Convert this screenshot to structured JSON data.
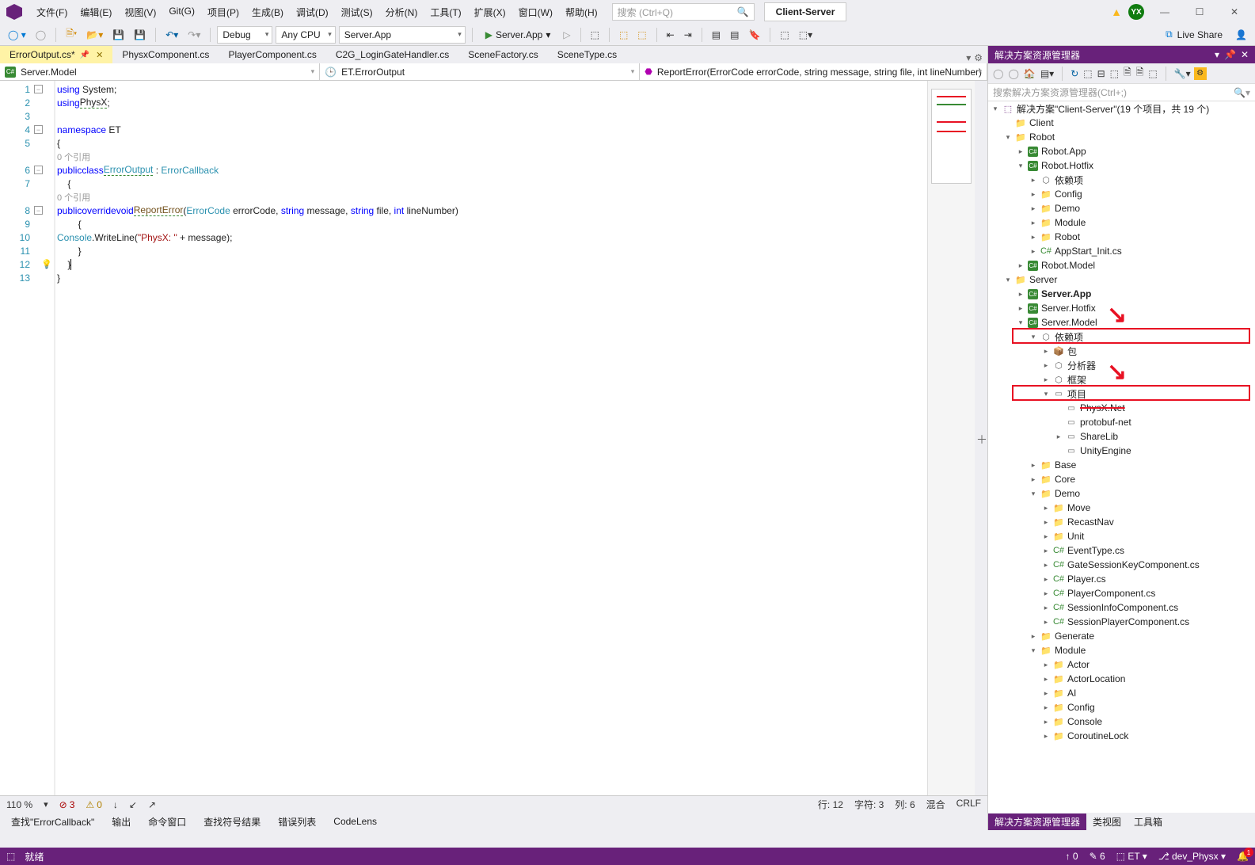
{
  "title": {
    "solution_name": "Client-Server",
    "avatar": "YX"
  },
  "menu": [
    "文件(F)",
    "编辑(E)",
    "视图(V)",
    "Git(G)",
    "项目(P)",
    "生成(B)",
    "调试(D)",
    "测试(S)",
    "分析(N)",
    "工具(T)",
    "扩展(X)",
    "窗口(W)",
    "帮助(H)"
  ],
  "search_placeholder": "搜索 (Ctrl+Q)",
  "toolbar": {
    "config": "Debug",
    "platform": "Any CPU",
    "startup": "Server.App",
    "run": "Server.App",
    "liveshare": "Live Share"
  },
  "tabs": [
    {
      "label": "ErrorOutput.cs*",
      "active": true,
      "pinned": true
    },
    {
      "label": "PhysxComponent.cs"
    },
    {
      "label": "PlayerComponent.cs"
    },
    {
      "label": "C2G_LoginGateHandler.cs"
    },
    {
      "label": "SceneFactory.cs"
    },
    {
      "label": "SceneType.cs"
    }
  ],
  "navbar": {
    "scope": "Server.Model",
    "class": "ET.ErrorOutput",
    "member": "ReportError(ErrorCode errorCode, string message, string file, int lineNumber)"
  },
  "code": {
    "ref0": "0 个引用",
    "lines": [
      {
        "n": 1,
        "html": "<span class='kw'>using</span> System;"
      },
      {
        "n": 2,
        "html": "<span class='kw'>using</span> <span class='squiggle'>PhysX</span>;"
      },
      {
        "n": 3,
        "html": ""
      },
      {
        "n": 4,
        "html": "<span class='kw'>namespace</span> ET"
      },
      {
        "n": 5,
        "html": "{"
      },
      {
        "n": "",
        "html": "    <span class='ref'>0 个引用</span>"
      },
      {
        "n": 6,
        "html": "    <span class='kw'>public</span> <span class='kw'>class</span> <span class='cls squiggle'>ErrorOutput</span> : <span class='cls'>ErrorCallback</span>"
      },
      {
        "n": 7,
        "html": "    {"
      },
      {
        "n": "",
        "html": "        <span class='ref'>0 个引用</span>"
      },
      {
        "n": 8,
        "html": "        <span class='kw'>public</span> <span class='kw'>override</span> <span class='kw'>void</span> <span class='squiggle' style='color:#74531f'>ReportError</span>(<span class='cls'>ErrorCode</span> errorCode, <span class='kw'>string</span> message, <span class='kw'>string</span> file, <span class='kw'>int</span> lineNumber)"
      },
      {
        "n": 9,
        "html": "        {"
      },
      {
        "n": 10,
        "html": "            <span class='cls'>Console</span>.WriteLine(<span class='str'>\"PhysX: \"</span> + message);"
      },
      {
        "n": 11,
        "html": "        }"
      },
      {
        "n": 12,
        "html": "    }<span class='caret'></span>"
      },
      {
        "n": 13,
        "html": "}"
      }
    ]
  },
  "editor_status": {
    "zoom": "110 %",
    "errors": "3",
    "warnings": "0",
    "line": "行: 12",
    "char": "字符: 3",
    "col": "列: 6",
    "mixed": "混合",
    "crlf": "CRLF"
  },
  "bottom_tabs": [
    "查找\"ErrorCallback\"",
    "输出",
    "命令窗口",
    "查找符号结果",
    "错误列表",
    "CodeLens"
  ],
  "solution": {
    "title": "解决方案资源管理器",
    "search_placeholder": "搜索解决方案资源管理器(Ctrl+;)",
    "root": "解决方案\"Client-Server\"(19 个项目，共 19 个)",
    "tabs": [
      "解决方案资源管理器",
      "类视图",
      "工具箱"
    ],
    "tree": [
      {
        "d": 1,
        "c": "",
        "i": "fold",
        "t": "Client"
      },
      {
        "d": 1,
        "c": "▾",
        "i": "fold",
        "t": "Robot"
      },
      {
        "d": 2,
        "c": "▸",
        "i": "cs",
        "t": "Robot.App"
      },
      {
        "d": 2,
        "c": "▾",
        "i": "cs",
        "t": "Robot.Hotfix"
      },
      {
        "d": 3,
        "c": "▸",
        "i": "dep",
        "t": "依赖项"
      },
      {
        "d": 3,
        "c": "▸",
        "i": "fold",
        "t": "Config"
      },
      {
        "d": 3,
        "c": "▸",
        "i": "fold",
        "t": "Demo"
      },
      {
        "d": 3,
        "c": "▸",
        "i": "fold",
        "t": "Module"
      },
      {
        "d": 3,
        "c": "▸",
        "i": "fold",
        "t": "Robot"
      },
      {
        "d": 3,
        "c": "▸",
        "i": "csfile",
        "t": "AppStart_Init.cs"
      },
      {
        "d": 2,
        "c": "▸",
        "i": "cs",
        "t": "Robot.Model"
      },
      {
        "d": 1,
        "c": "▾",
        "i": "fold",
        "t": "Server"
      },
      {
        "d": 2,
        "c": "▸",
        "i": "cs",
        "t": "Server.App",
        "b": true
      },
      {
        "d": 2,
        "c": "▸",
        "i": "cs",
        "t": "Server.Hotfix"
      },
      {
        "d": 2,
        "c": "▾",
        "i": "cs",
        "t": "Server.Model"
      },
      {
        "d": 3,
        "c": "▾",
        "i": "dep",
        "t": "依赖项",
        "hl": 1
      },
      {
        "d": 4,
        "c": "▸",
        "i": "pkg",
        "t": "包"
      },
      {
        "d": 4,
        "c": "▸",
        "i": "dep",
        "t": "分析器"
      },
      {
        "d": 4,
        "c": "▸",
        "i": "dep",
        "t": "框架"
      },
      {
        "d": 4,
        "c": "▾",
        "i": "ref",
        "t": "项目",
        "hl": 2
      },
      {
        "d": 5,
        "c": "",
        "i": "ref",
        "t": "PhysX.Net",
        "strike": true
      },
      {
        "d": 5,
        "c": "",
        "i": "ref",
        "t": "protobuf-net"
      },
      {
        "d": 5,
        "c": "▸",
        "i": "ref",
        "t": "ShareLib"
      },
      {
        "d": 5,
        "c": "",
        "i": "ref",
        "t": "UnityEngine"
      },
      {
        "d": 3,
        "c": "▸",
        "i": "fold",
        "t": "Base"
      },
      {
        "d": 3,
        "c": "▸",
        "i": "fold",
        "t": "Core"
      },
      {
        "d": 3,
        "c": "▾",
        "i": "fold",
        "t": "Demo"
      },
      {
        "d": 4,
        "c": "▸",
        "i": "fold",
        "t": "Move"
      },
      {
        "d": 4,
        "c": "▸",
        "i": "fold",
        "t": "RecastNav"
      },
      {
        "d": 4,
        "c": "▸",
        "i": "fold",
        "t": "Unit"
      },
      {
        "d": 4,
        "c": "▸",
        "i": "csfile",
        "t": "EventType.cs"
      },
      {
        "d": 4,
        "c": "▸",
        "i": "csfile",
        "t": "GateSessionKeyComponent.cs"
      },
      {
        "d": 4,
        "c": "▸",
        "i": "csfile",
        "t": "Player.cs"
      },
      {
        "d": 4,
        "c": "▸",
        "i": "csfile",
        "t": "PlayerComponent.cs"
      },
      {
        "d": 4,
        "c": "▸",
        "i": "csfile",
        "t": "SessionInfoComponent.cs"
      },
      {
        "d": 4,
        "c": "▸",
        "i": "csfile",
        "t": "SessionPlayerComponent.cs"
      },
      {
        "d": 3,
        "c": "▸",
        "i": "fold",
        "t": "Generate"
      },
      {
        "d": 3,
        "c": "▾",
        "i": "fold",
        "t": "Module"
      },
      {
        "d": 4,
        "c": "▸",
        "i": "fold",
        "t": "Actor"
      },
      {
        "d": 4,
        "c": "▸",
        "i": "fold",
        "t": "ActorLocation"
      },
      {
        "d": 4,
        "c": "▸",
        "i": "fold",
        "t": "AI"
      },
      {
        "d": 4,
        "c": "▸",
        "i": "fold",
        "t": "Config"
      },
      {
        "d": 4,
        "c": "▸",
        "i": "fold",
        "t": "Console"
      },
      {
        "d": 4,
        "c": "▸",
        "i": "fold",
        "t": "CoroutineLock"
      }
    ]
  },
  "statusbar": {
    "ready": "就绪",
    "arrows": "0",
    "pencil": "6",
    "repo": "ET",
    "branch": "dev_Physx",
    "bell": "1"
  }
}
